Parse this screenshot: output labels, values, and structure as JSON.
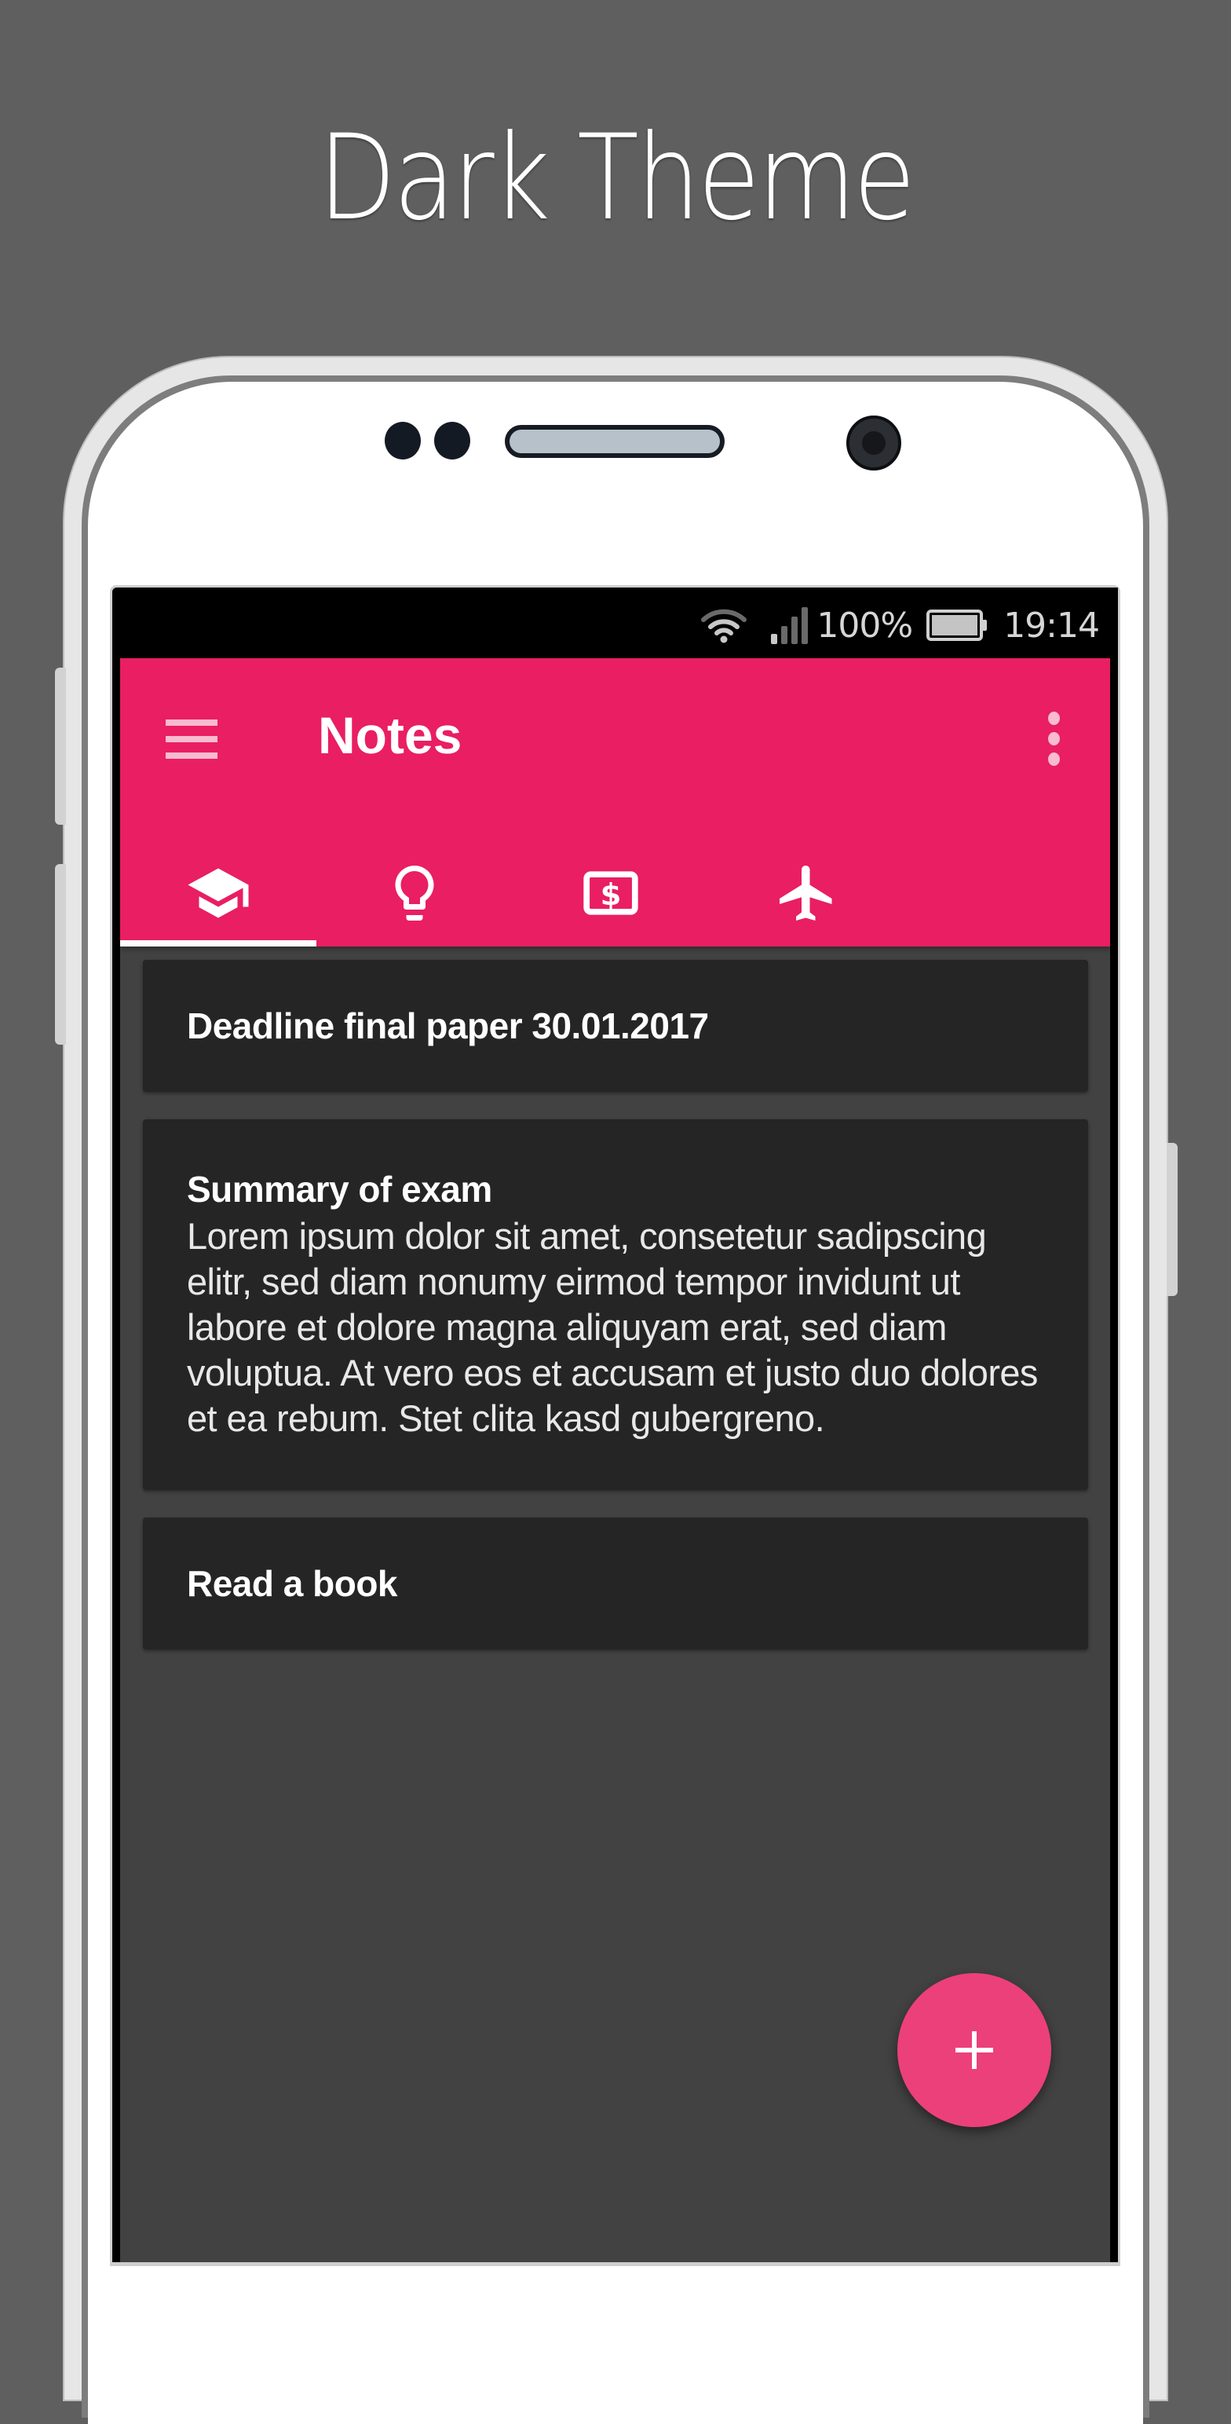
{
  "hero": {
    "title": "Dark Theme"
  },
  "status_bar": {
    "battery_percent": "100%",
    "time": "19:14",
    "icons": [
      "wifi-icon",
      "signal-icon",
      "battery-icon"
    ]
  },
  "app": {
    "title": "Notes",
    "menu_icon": "hamburger-menu-icon",
    "overflow_icon": "more-vertical-icon",
    "accent_color": "#e91e63",
    "fab_color": "#ec407a",
    "tabs": [
      {
        "icon": "graduation-cap-icon",
        "selected": true
      },
      {
        "icon": "lightbulb-icon",
        "selected": false
      },
      {
        "icon": "money-icon",
        "selected": false
      },
      {
        "icon": "airplane-icon",
        "selected": false
      }
    ],
    "notes": [
      {
        "title": "Deadline final paper 30.01.2017",
        "body": ""
      },
      {
        "title": "Summary of exam",
        "body": "Lorem ipsum dolor sit amet, consetetur sadipscing elitr, sed diam nonumy eirmod tempor invidunt ut labore et dolore magna aliquyam erat, sed diam voluptua. At vero eos et accusam et justo duo dolores et ea rebum. Stet clita kasd gubergreno."
      },
      {
        "title": "Read a book",
        "body": ""
      }
    ],
    "fab_icon": "plus-icon"
  }
}
